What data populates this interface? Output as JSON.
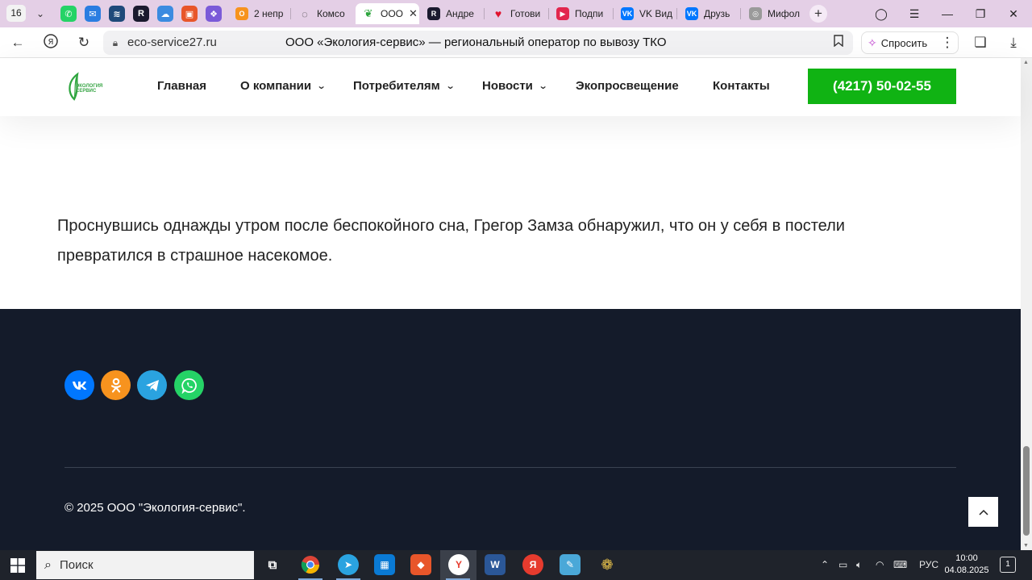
{
  "browser": {
    "tab_count": "16",
    "tabs": [
      {
        "title": "2 непр",
        "icon": "odnoklassniki-icon",
        "color": "#f7931e"
      },
      {
        "title": "Комсо",
        "icon": "loading-icon",
        "color": "#333333"
      },
      {
        "title": "ООО",
        "icon": "eco-leaf-icon",
        "color": "#2ea53e",
        "active": true
      },
      {
        "title": "Андре",
        "icon": "rutube-icon",
        "color": "#1a1a2e"
      },
      {
        "title": "Готови",
        "icon": "heart-icon",
        "color": "#e0132e"
      },
      {
        "title": "Подпи",
        "icon": "youtube-icon",
        "color": "#e2264d"
      },
      {
        "title": "VK Вид",
        "icon": "vk-icon",
        "color": "#0077ff"
      },
      {
        "title": "Друзь",
        "icon": "vk-icon",
        "color": "#0077ff"
      },
      {
        "title": "Мифол",
        "icon": "globe-icon",
        "color": "#9a9a9a"
      }
    ],
    "address": {
      "domain": "eco-service27.ru",
      "page_title": "ООО «Экология-сервис» — региональный оператор по вывозу ТКО"
    },
    "ask_button": "Спросить"
  },
  "site": {
    "logo_text": [
      "ЭКОЛОГИЯ",
      "СЕРВИС"
    ],
    "nav": [
      {
        "label": "Главная",
        "dropdown": false
      },
      {
        "label": "О компании",
        "dropdown": true
      },
      {
        "label": "Потребителям",
        "dropdown": true
      },
      {
        "label": "Новости",
        "dropdown": true
      },
      {
        "label": "Экопросвещение",
        "dropdown": false
      },
      {
        "label": "Контакты",
        "dropdown": false
      }
    ],
    "phone": "(4217) 50-02-55",
    "brand_green": "#10b313"
  },
  "content": {
    "text": "Проснувшись однажды утром после беспокойного сна, Грегор Замза обнаружил, что он у себя в постели превратился в страшное насекомое."
  },
  "footer": {
    "socials": [
      {
        "icon": "vk-icon",
        "color": "#0077ff"
      },
      {
        "icon": "odnoklassniki-icon",
        "color": "#f7931e"
      },
      {
        "icon": "telegram-icon",
        "color": "#2aa3e0"
      },
      {
        "icon": "whatsapp-icon",
        "color": "#25d366"
      }
    ],
    "copyright": "© 2025 ООО \"Экология-сервис\".",
    "background": "#141b2a"
  },
  "taskbar": {
    "search_placeholder": "Поиск",
    "language": "РУС",
    "time": "10:00",
    "date": "04.08.2025",
    "notifications": "1"
  }
}
